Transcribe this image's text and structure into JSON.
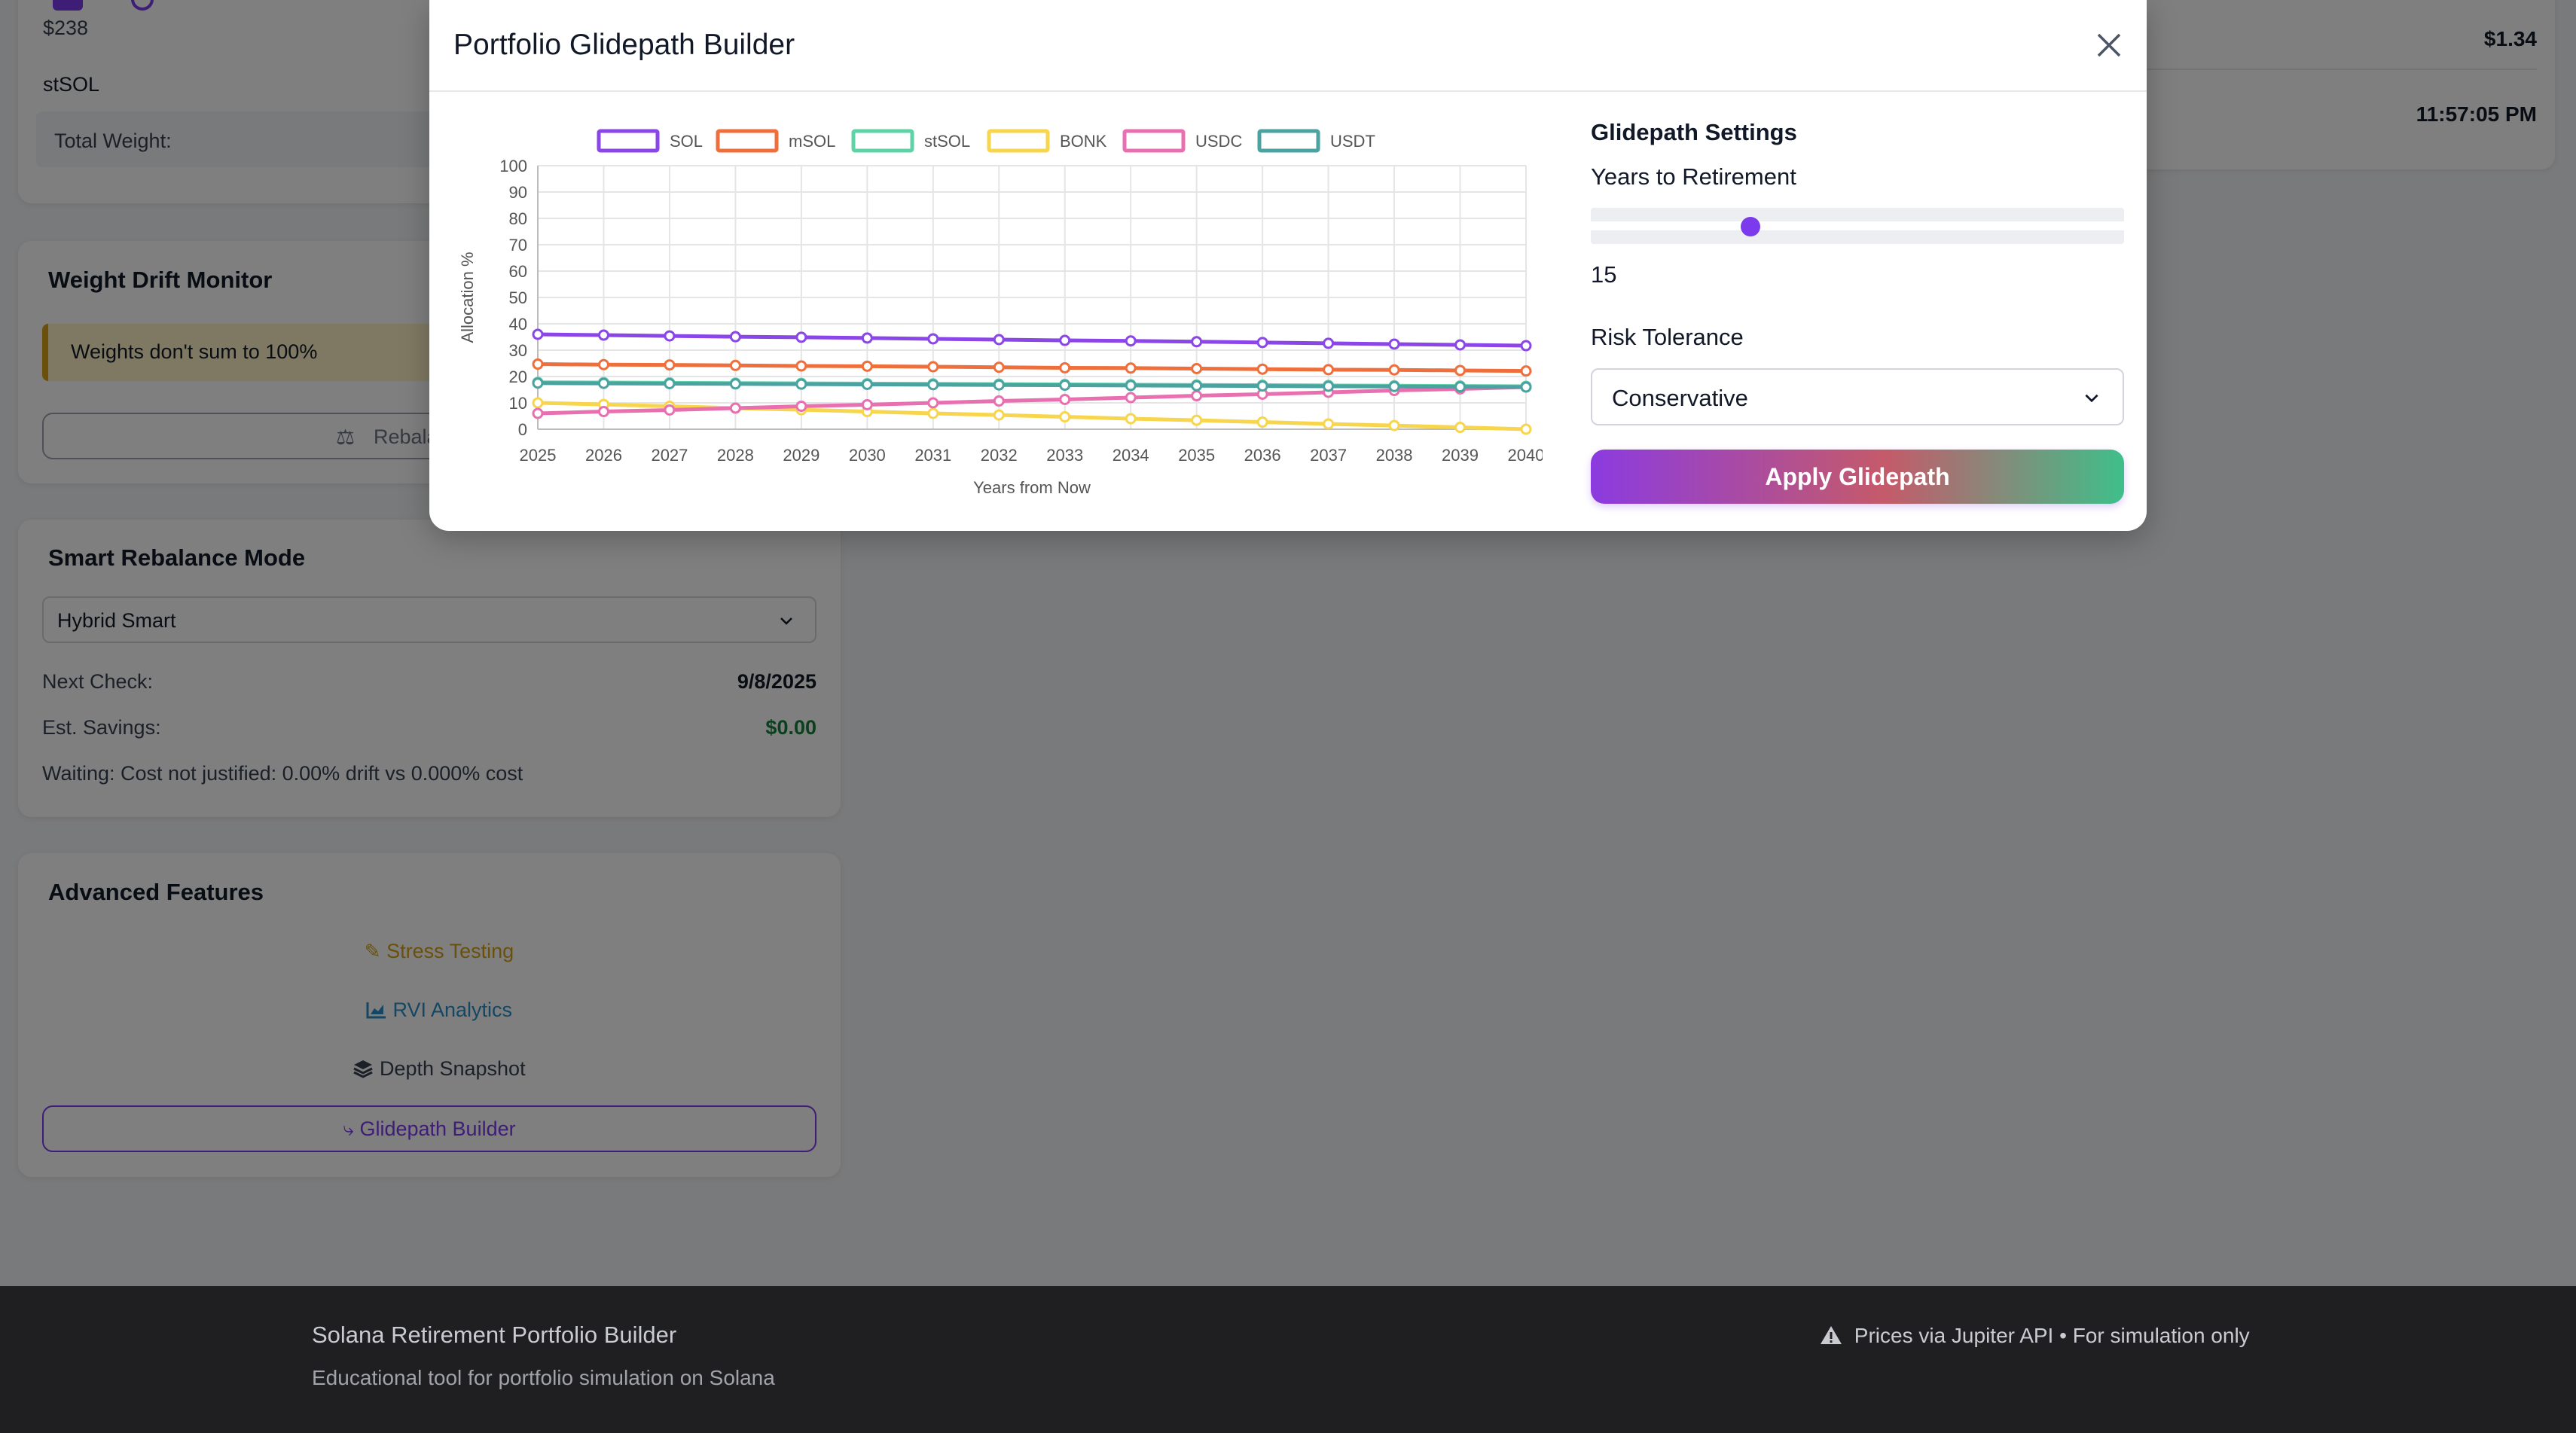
{
  "bg": {
    "top_value": "$238",
    "top_asset": "stSOL",
    "total_weight_label": "Total Weight:",
    "right_price": "$1.34",
    "right_time": "11:57:05 PM",
    "drift": {
      "title": "Weight Drift Monitor",
      "warning": "Weights don't sum to 100%",
      "rebalance_label": "Rebalan"
    },
    "smart": {
      "title": "Smart Rebalance Mode",
      "mode_value": "Hybrid Smart",
      "next_check_label": "Next Check:",
      "next_check_value": "9/8/2025",
      "savings_label": "Est. Savings:",
      "savings_value": "$0.00",
      "status_text": "Waiting: Cost not justified: 0.00% drift vs 0.000% cost"
    },
    "advanced": {
      "title": "Advanced Features",
      "stress": "Stress Testing",
      "rvi": "RVI Analytics",
      "depth": "Depth Snapshot",
      "glidepath": "Glidepath Builder"
    }
  },
  "footer": {
    "title": "Solana Retirement Portfolio Builder",
    "subtitle": "Educational tool for portfolio simulation on Solana",
    "notice": "Prices via Jupiter API • For simulation only"
  },
  "modal": {
    "title": "Portfolio Glidepath Builder",
    "settings_title": "Glidepath Settings",
    "years_label": "Years to Retirement",
    "years_value": "15",
    "years_fraction": 0.3,
    "risk_label": "Risk Tolerance",
    "risk_value": "Conservative",
    "apply_label": "Apply Glidepath"
  },
  "colors": {
    "accent_purple": "#7c3aed",
    "savings_green": "#15803d",
    "stress_amber": "#d4a017",
    "rvi_blue": "#2a8fc7"
  },
  "chart_data": {
    "type": "line",
    "xlabel": "Years from Now",
    "ylabel": "Allocation %",
    "ylim": [
      0,
      100
    ],
    "yticks": [
      0,
      10,
      20,
      30,
      40,
      50,
      60,
      70,
      80,
      90,
      100
    ],
    "x": [
      "2025",
      "2026",
      "2027",
      "2028",
      "2029",
      "2030",
      "2031",
      "2032",
      "2033",
      "2034",
      "2035",
      "2036",
      "2037",
      "2038",
      "2039",
      "2040"
    ],
    "legend_position": "top",
    "grid": true,
    "series": [
      {
        "name": "SOL",
        "color": "#8b46e8",
        "values": [
          36,
          35.7,
          35.4,
          35.1,
          34.9,
          34.6,
          34.3,
          34,
          33.7,
          33.5,
          33.2,
          32.9,
          32.6,
          32.3,
          32,
          31.7
        ]
      },
      {
        "name": "mSOL",
        "color": "#ef6f3c",
        "values": [
          24.7,
          24.5,
          24.4,
          24.2,
          24,
          23.9,
          23.7,
          23.5,
          23.3,
          23.2,
          23,
          22.8,
          22.6,
          22.5,
          22.3,
          22.1
        ]
      },
      {
        "name": "stSOL",
        "color": "#5ed3a8",
        "values": [
          17.8,
          17.7,
          17.6,
          17.5,
          17.4,
          17.3,
          17.2,
          17.1,
          17,
          16.9,
          16.8,
          16.7,
          16.6,
          16.5,
          16.4,
          16.3
        ]
      },
      {
        "name": "BONK",
        "color": "#f7d54c",
        "values": [
          10,
          9.4,
          8.7,
          8,
          7.4,
          6.7,
          6,
          5.4,
          4.7,
          4,
          3.4,
          2.7,
          2,
          1.4,
          0.7,
          0
        ]
      },
      {
        "name": "USDC",
        "color": "#e86fb0",
        "values": [
          6,
          6.7,
          7.3,
          8,
          8.7,
          9.3,
          10,
          10.7,
          11.3,
          12,
          12.7,
          13.3,
          14,
          14.7,
          15.3,
          16
        ]
      },
      {
        "name": "USDT",
        "color": "#4aa3a0",
        "values": [
          17.5,
          17.4,
          17.3,
          17.2,
          17.1,
          17,
          16.9,
          16.8,
          16.7,
          16.6,
          16.5,
          16.4,
          16.3,
          16.2,
          16.1,
          16
        ]
      }
    ]
  }
}
